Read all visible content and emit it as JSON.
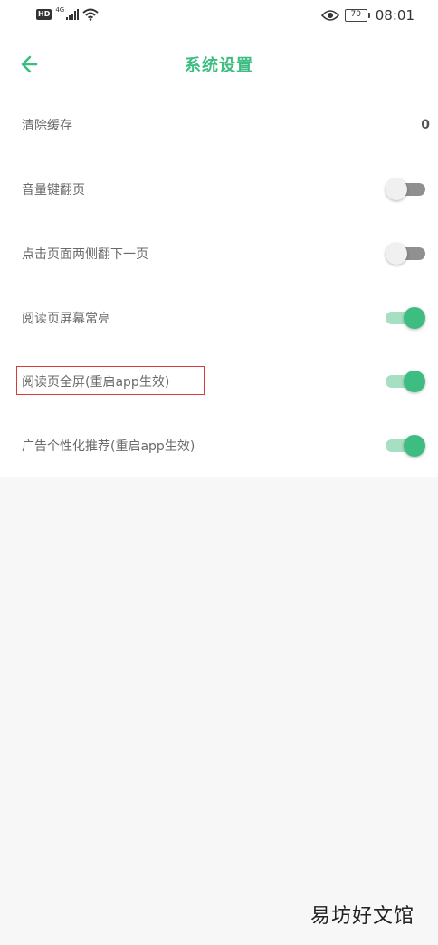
{
  "status_bar": {
    "hd_badge": "HD",
    "network": "4G",
    "battery": "70",
    "time": "08:01"
  },
  "header": {
    "title": "系统设置"
  },
  "settings": [
    {
      "label": "清除缓存",
      "value": "0"
    },
    {
      "label": "音量键翻页",
      "toggle": "off"
    },
    {
      "label": "点击页面两侧翻下一页",
      "toggle": "off"
    },
    {
      "label": "阅读页屏幕常亮",
      "toggle": "on"
    },
    {
      "label": "阅读页全屏(重启app生效)",
      "toggle": "on"
    },
    {
      "label": "广告个性化推荐(重启app生效)",
      "toggle": "on"
    }
  ],
  "colors": {
    "accent": "#3dbd82",
    "highlight_border": "#d93a3a"
  },
  "watermark": "易坊好文馆"
}
